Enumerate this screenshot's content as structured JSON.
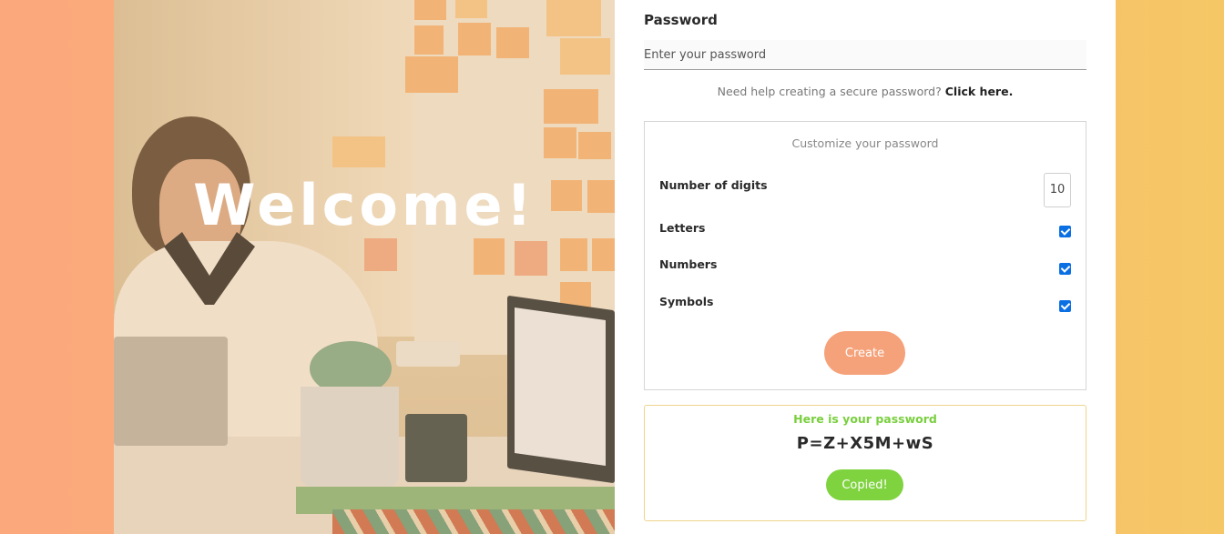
{
  "hero": {
    "heading": "Welcome!"
  },
  "form": {
    "password_label": "Password",
    "password_placeholder": "Enter your password",
    "help_text": "Need help creating a secure password?",
    "help_link": "Click here."
  },
  "customize": {
    "title": "Customize your password",
    "digits_label": "Number of digits",
    "digits_value": "10",
    "letters_label": "Letters",
    "letters_checked": true,
    "numbers_label": "Numbers",
    "numbers_checked": true,
    "symbols_label": "Symbols",
    "symbols_checked": true,
    "create_label": "Create"
  },
  "result": {
    "title": "Here is your password",
    "password": "P=Z+X5M+wS",
    "copied_label": "Copied!"
  },
  "colors": {
    "accent_orange": "#f5a27a",
    "success_green": "#7fd33f",
    "checkbox_blue": "#0b6fe4"
  }
}
